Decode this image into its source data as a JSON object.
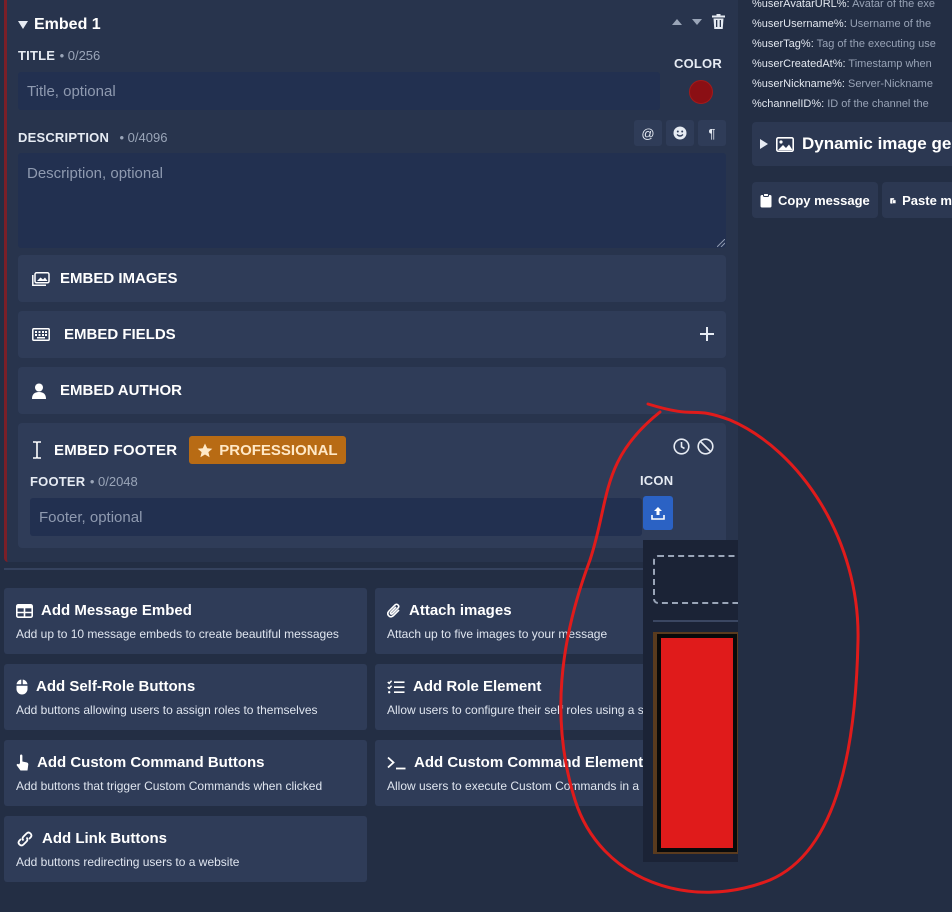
{
  "embed": {
    "heading": "Embed 1",
    "title_label": "TITLE",
    "title_count": "• 0/256",
    "title_placeholder": "Title, optional",
    "color_label": "COLOR",
    "color_value": "#8b0f14",
    "description_label": "DESCRIPTION",
    "description_count": "• 0/4096",
    "description_placeholder": "Description, optional",
    "sections": {
      "images": "EMBED IMAGES",
      "fields": "EMBED FIELDS",
      "author": "EMBED AUTHOR",
      "footer": "EMBED FOOTER"
    },
    "professional_badge": "PROFESSIONAL",
    "footer_label": "FOOTER",
    "footer_count": "• 0/2048",
    "footer_placeholder": "Footer, optional",
    "icon_label": "ICON"
  },
  "tiles": [
    {
      "title": "Add Message Embed",
      "desc": "Add up to 10 message embeds to create beautiful messages",
      "icon": "table-icon"
    },
    {
      "title": "Attach images",
      "desc": "Attach up to five images to your message",
      "icon": "paperclip-icon"
    },
    {
      "title": "Add Self-Role Buttons",
      "desc": "Add buttons allowing users to assign roles to themselves",
      "icon": "mouse-icon"
    },
    {
      "title": "Add Role Element",
      "desc": "Allow users to configure their self roles using a s",
      "icon": "checklist-icon"
    },
    {
      "title": "Add Custom Command Buttons",
      "desc": "Add buttons that trigger Custom Commands when clicked",
      "icon": "pointer-hand-icon"
    },
    {
      "title": "Add Custom Command Element",
      "desc": "Allow users to execute Custom Commands in a d",
      "icon": "terminal-icon"
    },
    {
      "title": "Add Link Buttons",
      "desc": "Add buttons redirecting users to a website",
      "icon": "link-icon"
    }
  ],
  "variables": [
    {
      "name": "%userAvatarURL%:",
      "desc": " Avatar of the exe"
    },
    {
      "name": "%userUsername%:",
      "desc": " Username of the"
    },
    {
      "name": "%userTag%:",
      "desc": " Tag of the executing use"
    },
    {
      "name": "%userCreatedAt%:",
      "desc": " Timestamp when"
    },
    {
      "name": "%userNickname%:",
      "desc": " Server-Nickname"
    },
    {
      "name": "%channelID%:",
      "desc": " ID of the channel the"
    }
  ],
  "dynamic_image": "Dynamic image ge",
  "copy_message": "Copy message",
  "paste_message": "Paste m",
  "colors": {
    "background": "#232e44",
    "card": "#28344d",
    "section": "#2f3c58",
    "accent_left_border": "#7a1f28",
    "professional": "#b86b14",
    "upload": "#2b62c4",
    "annotation": "#e01b1b"
  }
}
